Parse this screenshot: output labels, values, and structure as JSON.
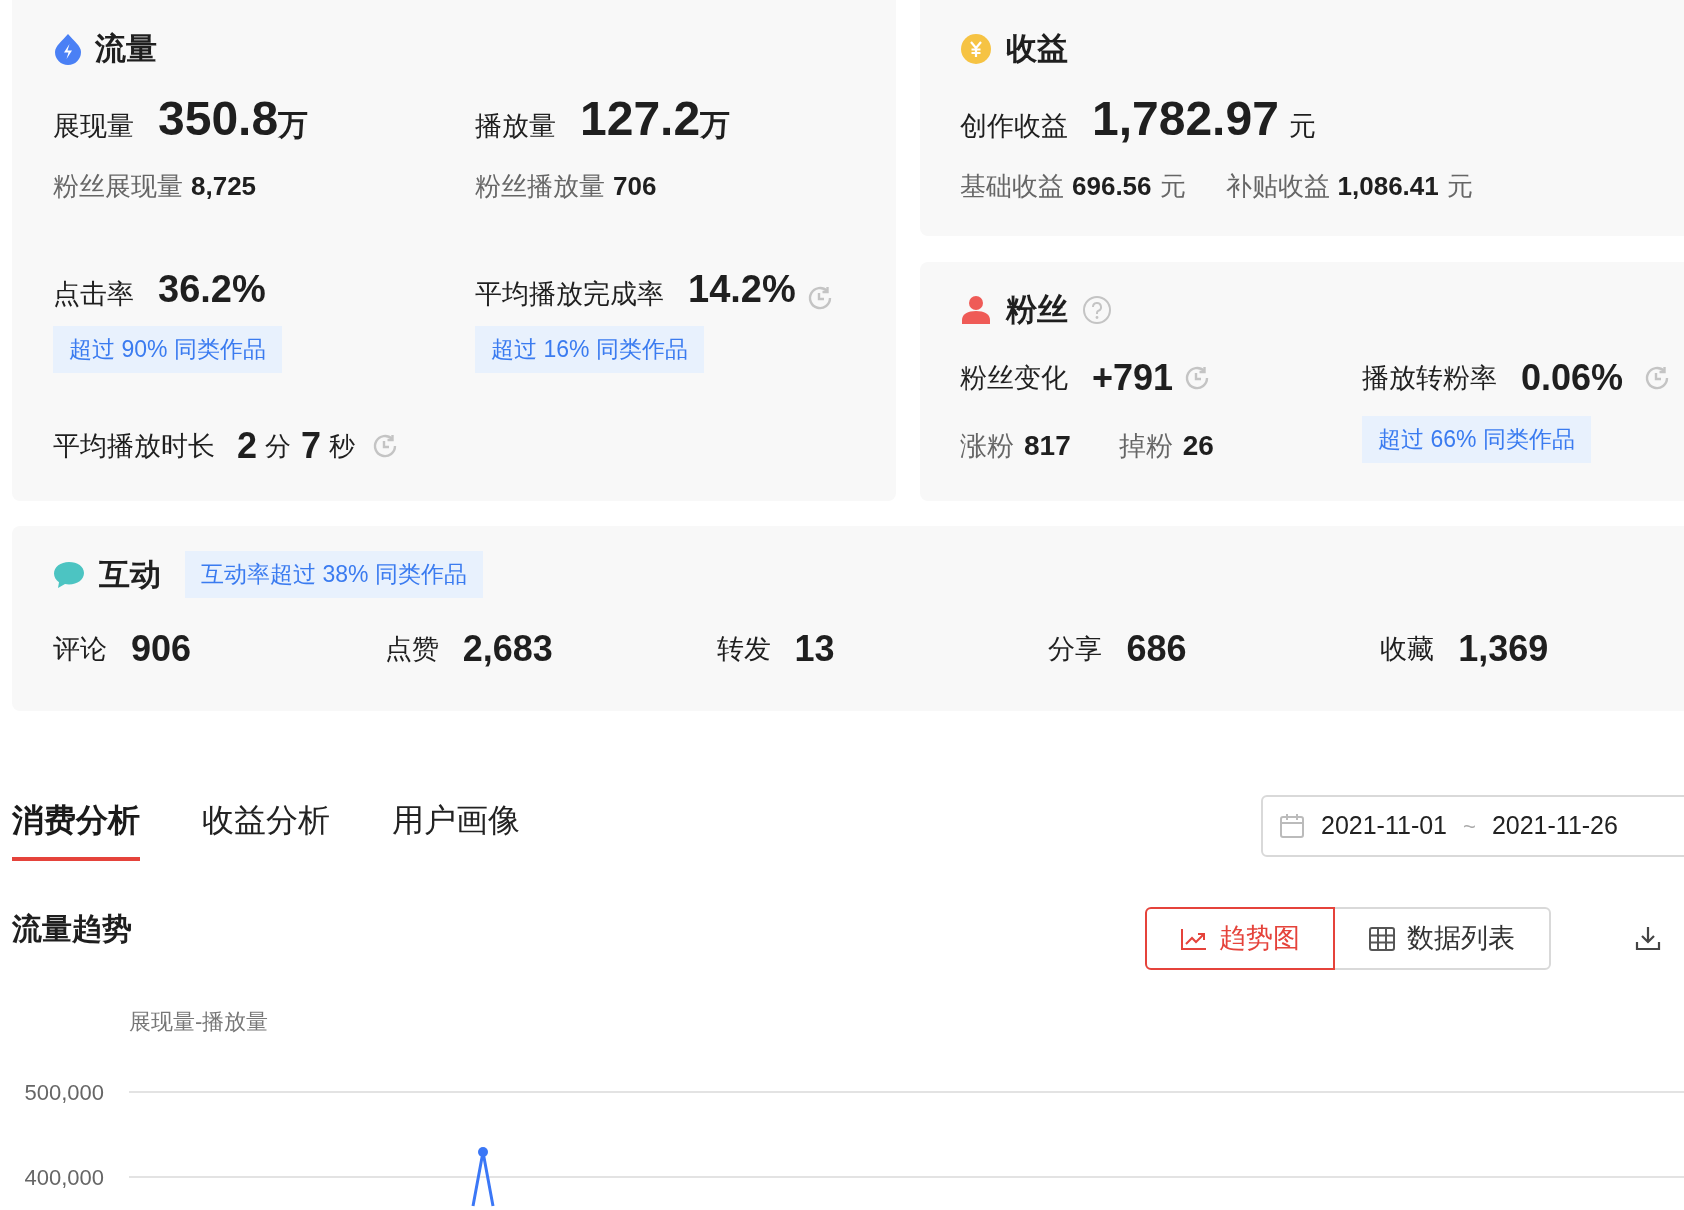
{
  "traffic": {
    "title": "流量",
    "metrics": [
      {
        "label": "展现量",
        "value": "350.8",
        "unit": "万",
        "sub_label": "粉丝展现量",
        "sub_value": "8,725"
      },
      {
        "label": "播放量",
        "value": "127.2",
        "unit": "万",
        "sub_label": "粉丝播放量",
        "sub_value": "706"
      },
      {
        "label": "点击率",
        "value": "36.2%",
        "badge": "超过 90% 同类作品",
        "history_icon": false
      },
      {
        "label": "平均播放完成率",
        "value": "14.2%",
        "badge": "超过 16% 同类作品",
        "history_icon": true
      }
    ],
    "duration": {
      "label": "平均播放时长",
      "minutes": "2",
      "minute_unit": "分",
      "seconds": "7",
      "second_unit": "秒",
      "history_icon": true
    }
  },
  "revenue": {
    "title": "收益",
    "main": {
      "label": "创作收益",
      "value": "1,782.97",
      "unit": "元"
    },
    "parts": [
      {
        "label": "基础收益",
        "value": "696.56",
        "unit": "元"
      },
      {
        "label": "补贴收益",
        "value": "1,086.41",
        "unit": "元"
      }
    ]
  },
  "fans": {
    "title": "粉丝",
    "change": {
      "label": "粉丝变化",
      "value": "+791",
      "history_icon": true
    },
    "gain": {
      "label": "涨粉",
      "value": "817"
    },
    "loss": {
      "label": "掉粉",
      "value": "26"
    },
    "conversion": {
      "label": "播放转粉率",
      "value": "0.06%",
      "history_icon": true,
      "badge": "超过 66% 同类作品"
    }
  },
  "interaction": {
    "title": "互动",
    "badge": "互动率超过 38% 同类作品",
    "metrics": [
      {
        "label": "评论",
        "value": "906"
      },
      {
        "label": "点赞",
        "value": "2,683"
      },
      {
        "label": "转发",
        "value": "13"
      },
      {
        "label": "分享",
        "value": "686"
      },
      {
        "label": "收藏",
        "value": "1,369"
      }
    ]
  },
  "tabs": [
    {
      "label": "消费分析",
      "selected": true
    },
    {
      "label": "收益分析",
      "selected": false
    },
    {
      "label": "用户画像",
      "selected": false
    }
  ],
  "date_range": {
    "start": "2021-11-01",
    "separator": "~",
    "end": "2021-11-26"
  },
  "trend": {
    "title": "流量趋势",
    "views": [
      {
        "label": "趋势图",
        "kind": "chart",
        "selected": true
      },
      {
        "label": "数据列表",
        "kind": "table",
        "selected": false
      }
    ],
    "chart": {
      "title": "展现量-播放量",
      "y_axis_labels": [
        "500,000",
        "400,000"
      ]
    }
  }
}
